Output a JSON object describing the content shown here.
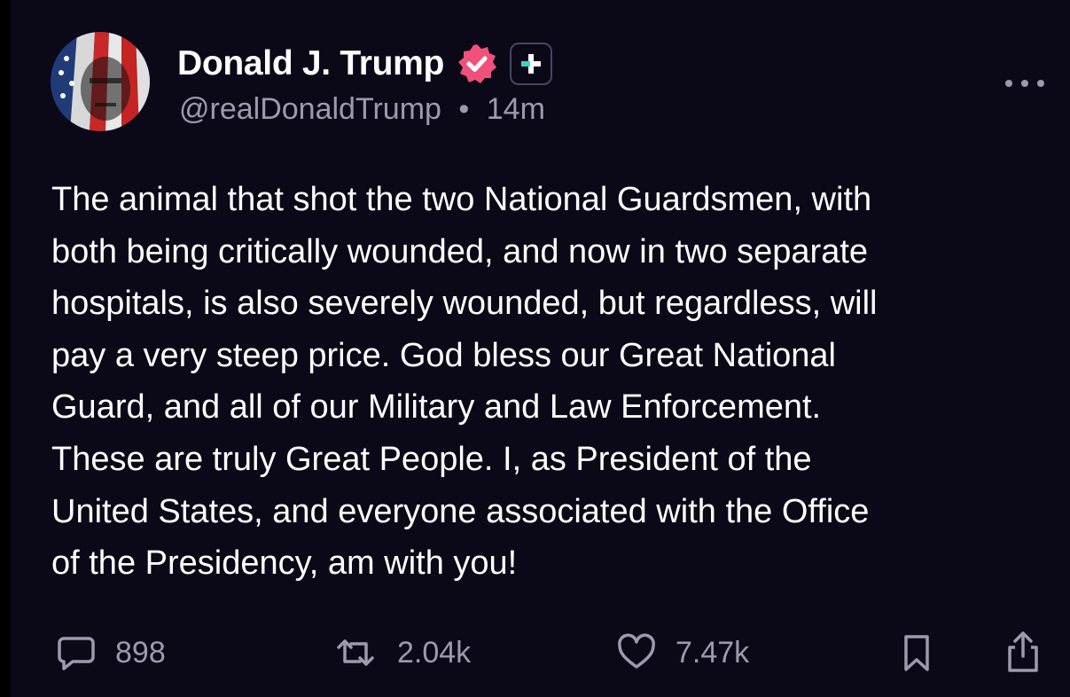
{
  "author": {
    "display_name": "Donald J. Trump",
    "handle": "@realDonaldTrump",
    "separator": "•",
    "time_ago": "14m",
    "avatar_icon": "portrait-flag-avatar",
    "verified_icon": "verified-badge-icon",
    "plus_icon": "plus-subscribe-icon"
  },
  "post": {
    "text": "The animal that shot the two National Guardsmen, with\nboth being critically wounded, and now in two separate\nhospitals, is also severely wounded, but regardless, will\npay a very steep price. God bless our Great National\nGuard, and all of our Military and Law Enforcement.\nThese are truly Great People. I, as President of the\nUnited States, and everyone associated with the Office\nof the Presidency, am with you!"
  },
  "actions": {
    "replies": {
      "icon": "comment-icon",
      "count": "898"
    },
    "reposts": {
      "icon": "repost-icon",
      "count": "2.04k"
    },
    "likes": {
      "icon": "heart-icon",
      "count": "7.47k"
    },
    "bookmark": {
      "icon": "bookmark-icon"
    },
    "share": {
      "icon": "share-icon"
    }
  },
  "colors": {
    "background": "#0b0818",
    "text": "#ffffff",
    "muted": "#9e9aae",
    "verified": "#f0517a",
    "plus_accent": "#35d6c8"
  }
}
